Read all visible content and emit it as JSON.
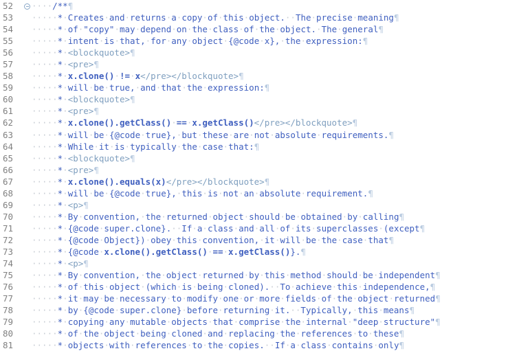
{
  "editor": {
    "kind": "java-source-editor",
    "whitespace_visible": true,
    "space_glyph": "·",
    "newline_glyph": "¶",
    "colors": {
      "background": "#ffffff",
      "line_number": "#808080",
      "javadoc_text": "#3f5fbf",
      "javadoc_tag": "#7f9fbf",
      "whitespace_dot": "#c8cdd4",
      "pilcrow": "#b9cbe0",
      "fold_marker": "#8aa8c8"
    },
    "first_line_number": 52,
    "last_line_number": 81
  },
  "lines": [
    {
      "number": "52",
      "fold": "collapse-marker",
      "indent": 4,
      "segments": [
        {
          "text": "/**",
          "style": "jdopen"
        }
      ],
      "newline": "¶"
    },
    {
      "number": "53",
      "fold": "",
      "indent": 5,
      "segments": [
        {
          "text": "* Creates and returns a copy of this object.  The precise meaning",
          "style": "jd"
        }
      ],
      "newline": "¶"
    },
    {
      "number": "54",
      "fold": "",
      "indent": 5,
      "segments": [
        {
          "text": "* of \"copy\" may depend on the class of the object. The general",
          "style": "jd"
        }
      ],
      "newline": "¶"
    },
    {
      "number": "55",
      "fold": "",
      "indent": 5,
      "segments": [
        {
          "text": "* intent is that, for any object {@code x}, the expression:",
          "style": "jd"
        }
      ],
      "newline": "¶"
    },
    {
      "number": "56",
      "fold": "",
      "indent": 5,
      "segments": [
        {
          "text": "* ",
          "style": "jd"
        },
        {
          "text": "<blockquote>",
          "style": "jdtag"
        }
      ],
      "newline": "¶"
    },
    {
      "number": "57",
      "fold": "",
      "indent": 5,
      "segments": [
        {
          "text": "* ",
          "style": "jd"
        },
        {
          "text": "<pre>",
          "style": "jdtag"
        }
      ],
      "newline": "¶"
    },
    {
      "number": "58",
      "fold": "",
      "indent": 5,
      "segments": [
        {
          "text": "* ",
          "style": "jd"
        },
        {
          "text": "x.clone() != x",
          "style": "jdcode"
        },
        {
          "text": "</pre></blockquote>",
          "style": "jdtag"
        }
      ],
      "newline": "¶"
    },
    {
      "number": "59",
      "fold": "",
      "indent": 5,
      "segments": [
        {
          "text": "* will be true, and that the expression:",
          "style": "jd"
        }
      ],
      "newline": "¶"
    },
    {
      "number": "60",
      "fold": "",
      "indent": 5,
      "segments": [
        {
          "text": "* ",
          "style": "jd"
        },
        {
          "text": "<blockquote>",
          "style": "jdtag"
        }
      ],
      "newline": "¶"
    },
    {
      "number": "61",
      "fold": "",
      "indent": 5,
      "segments": [
        {
          "text": "* ",
          "style": "jd"
        },
        {
          "text": "<pre>",
          "style": "jdtag"
        }
      ],
      "newline": "¶"
    },
    {
      "number": "62",
      "fold": "",
      "indent": 5,
      "segments": [
        {
          "text": "* ",
          "style": "jd"
        },
        {
          "text": "x.clone().getClass() == x.getClass()",
          "style": "jdcode"
        },
        {
          "text": "</pre></blockquote>",
          "style": "jdtag"
        }
      ],
      "newline": "¶"
    },
    {
      "number": "63",
      "fold": "",
      "indent": 5,
      "segments": [
        {
          "text": "* will be {@code true}, but these are not absolute requirements.",
          "style": "jd"
        }
      ],
      "newline": "¶"
    },
    {
      "number": "64",
      "fold": "",
      "indent": 5,
      "segments": [
        {
          "text": "* While it is typically the case that:",
          "style": "jd"
        }
      ],
      "newline": "¶"
    },
    {
      "number": "65",
      "fold": "",
      "indent": 5,
      "segments": [
        {
          "text": "* ",
          "style": "jd"
        },
        {
          "text": "<blockquote>",
          "style": "jdtag"
        }
      ],
      "newline": "¶"
    },
    {
      "number": "66",
      "fold": "",
      "indent": 5,
      "segments": [
        {
          "text": "* ",
          "style": "jd"
        },
        {
          "text": "<pre>",
          "style": "jdtag"
        }
      ],
      "newline": "¶"
    },
    {
      "number": "67",
      "fold": "",
      "indent": 5,
      "segments": [
        {
          "text": "* ",
          "style": "jd"
        },
        {
          "text": "x.clone().equals(x)",
          "style": "jdcode"
        },
        {
          "text": "</pre></blockquote>",
          "style": "jdtag"
        }
      ],
      "newline": "¶"
    },
    {
      "number": "68",
      "fold": "",
      "indent": 5,
      "segments": [
        {
          "text": "* will be {@code true}, this is not an absolute requirement.",
          "style": "jd"
        }
      ],
      "newline": "¶"
    },
    {
      "number": "69",
      "fold": "",
      "indent": 5,
      "segments": [
        {
          "text": "* ",
          "style": "jd"
        },
        {
          "text": "<p>",
          "style": "jdtag"
        }
      ],
      "newline": "¶"
    },
    {
      "number": "70",
      "fold": "",
      "indent": 5,
      "segments": [
        {
          "text": "* By convention, the returned object should be obtained by calling",
          "style": "jd"
        }
      ],
      "newline": "¶"
    },
    {
      "number": "71",
      "fold": "",
      "indent": 5,
      "segments": [
        {
          "text": "* {@code super.clone}.  If a class and all of its superclasses (except",
          "style": "jd"
        }
      ],
      "newline": "¶"
    },
    {
      "number": "72",
      "fold": "",
      "indent": 5,
      "segments": [
        {
          "text": "* {@code Object}) obey this convention, it will be the case that",
          "style": "jd"
        }
      ],
      "newline": "¶"
    },
    {
      "number": "73",
      "fold": "",
      "indent": 5,
      "segments": [
        {
          "text": "* {@code ",
          "style": "jd"
        },
        {
          "text": "x.clone().getClass() == x.getClass()",
          "style": "jdcode"
        },
        {
          "text": "}.",
          "style": "jd"
        }
      ],
      "newline": "¶"
    },
    {
      "number": "74",
      "fold": "",
      "indent": 5,
      "segments": [
        {
          "text": "* ",
          "style": "jd"
        },
        {
          "text": "<p>",
          "style": "jdtag"
        }
      ],
      "newline": "¶"
    },
    {
      "number": "75",
      "fold": "",
      "indent": 5,
      "segments": [
        {
          "text": "* By convention, the object returned by this method should be independent",
          "style": "jd"
        }
      ],
      "newline": "¶"
    },
    {
      "number": "76",
      "fold": "",
      "indent": 5,
      "segments": [
        {
          "text": "* of this object (which is being cloned).  To achieve this independence,",
          "style": "jd"
        }
      ],
      "newline": "¶"
    },
    {
      "number": "77",
      "fold": "",
      "indent": 5,
      "segments": [
        {
          "text": "* it may be necessary to modify one or more fields of the object returned",
          "style": "jd"
        }
      ],
      "newline": "¶"
    },
    {
      "number": "78",
      "fold": "",
      "indent": 5,
      "segments": [
        {
          "text": "* by {@code super.clone} before returning it.  Typically, this means",
          "style": "jd"
        }
      ],
      "newline": "¶"
    },
    {
      "number": "79",
      "fold": "",
      "indent": 5,
      "segments": [
        {
          "text": "* copying any mutable objects that comprise the internal \"deep structure\"",
          "style": "jd"
        }
      ],
      "newline": "¶"
    },
    {
      "number": "80",
      "fold": "",
      "indent": 5,
      "segments": [
        {
          "text": "* of the object being cloned and replacing the references to these",
          "style": "jd"
        }
      ],
      "newline": "¶"
    },
    {
      "number": "81",
      "fold": "",
      "indent": 5,
      "segments": [
        {
          "text": "* objects with references to the copies.  If a class contains only",
          "style": "jd"
        }
      ],
      "newline": "¶"
    }
  ]
}
